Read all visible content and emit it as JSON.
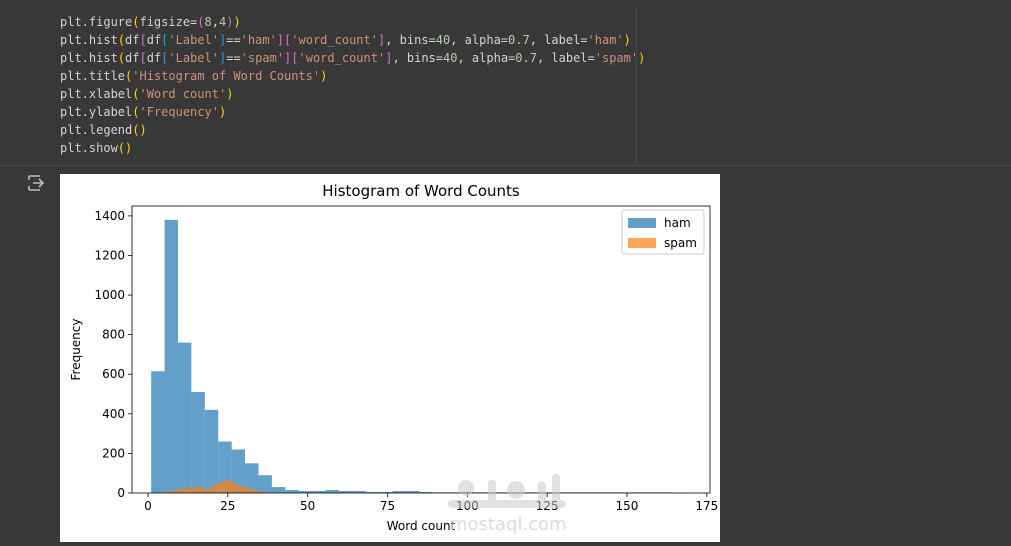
{
  "code_cell": {
    "lines": [
      "plt.figure(figsize=(8,4))",
      "plt.hist(df[df['Label']=='ham']['word_count'], bins=40, alpha=0.7, label='ham')",
      "plt.hist(df[df['Label']=='spam']['word_count'], bins=40, alpha=0.7, label='spam')",
      "plt.title('Histogram of Word Counts')",
      "plt.xlabel('Word count')",
      "plt.ylabel('Frequency')",
      "plt.legend()",
      "plt.show()"
    ]
  },
  "icons": {
    "run": "play-circle-icon",
    "output": "output-toggle-icon"
  },
  "watermark": {
    "text": "mostaql.com"
  },
  "chart_data": {
    "type": "bar",
    "title": "Histogram of Word Counts",
    "xlabel": "Word count",
    "ylabel": "Frequency",
    "xlim": [
      -5,
      176
    ],
    "ylim": [
      0,
      1450
    ],
    "xticks": [
      0,
      25,
      50,
      75,
      100,
      125,
      150,
      175
    ],
    "yticks": [
      0,
      200,
      400,
      600,
      800,
      1000,
      1200,
      1400
    ],
    "legend_position": "top-right",
    "colors": {
      "ham": "#1f77b4",
      "spam": "#ff7f0e"
    },
    "alpha": 0.7,
    "series": [
      {
        "name": "ham",
        "bin_width": 4.2,
        "bin_start": 1,
        "values": [
          615,
          1380,
          760,
          510,
          420,
          260,
          220,
          150,
          90,
          30,
          15,
          10,
          10,
          15,
          10,
          10,
          5,
          5,
          10,
          10,
          5,
          3,
          3,
          5,
          3,
          3,
          3,
          3,
          3,
          3,
          3,
          3,
          3,
          3,
          3,
          3,
          3,
          3,
          3,
          2
        ]
      },
      {
        "name": "spam",
        "bin_width": 1.0,
        "bin_start": 2,
        "values": [
          2,
          3,
          5,
          8,
          10,
          10,
          15,
          20,
          25,
          20,
          20,
          30,
          25,
          35,
          30,
          20,
          15,
          25,
          40,
          45,
          50,
          60,
          70,
          65,
          55,
          45,
          40,
          35,
          30,
          25,
          20,
          15,
          10,
          8,
          5,
          3,
          2,
          2,
          1,
          1
        ]
      }
    ]
  }
}
